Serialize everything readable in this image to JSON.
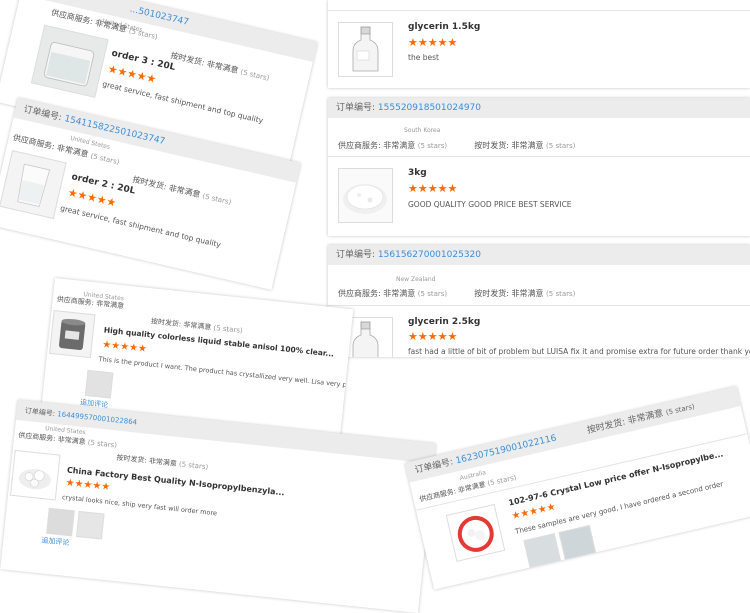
{
  "review_labels": {
    "order_no": "订单编号:",
    "supplier_service": "供应商服务:",
    "ship_on_time": "按时发货:",
    "very_satisfied": "非常满意",
    "five_stars": "(5 stars)",
    "additional_review": "追加评论"
  },
  "star_rating": "★★★★★",
  "reviews_right": [
    {
      "product": "glycerin 1.5kg",
      "text": "the best"
    },
    {
      "order_number": "155520918501024970",
      "country": "South Korea",
      "product": "3kg",
      "text": "GOOD QUALITY GOOD PRICE BEST SERVICE"
    },
    {
      "order_number": "156156270001025320",
      "country": "New Zealand",
      "product": "glycerin 2.5kg",
      "text": "fast had a little of bit of problem but LUISA fix it and promise extra for future order thank you"
    }
  ],
  "reviews_left": [
    {
      "order_number": "...501023747",
      "country": "United States",
      "product": "order 3 : 20L",
      "text": "great service, fast shipment and top quality"
    },
    {
      "order_number": "154115822501023747",
      "country": "United States",
      "product": "order 2 : 20L",
      "text": "great service, fast shipment and top quality"
    },
    {
      "country": "United States",
      "product": "High quality colorless liquid stable anisol 100% clear...",
      "text": "This is the product I want. The product has crystallized very well. Lisa very patient"
    },
    {
      "order_number": "164499570001022864",
      "country": "United States",
      "product": "China Factory Best Quality N-Isopropylbenzyla...",
      "text": "crystal looks nice, ship very fast will order more"
    },
    {
      "order_number": "162307519001022116",
      "country": "Australia",
      "product": "102-97-6 Crystal Low price offer N-Isopropylbe...",
      "text": "These samples are very good, I have ordered a second order"
    }
  ]
}
